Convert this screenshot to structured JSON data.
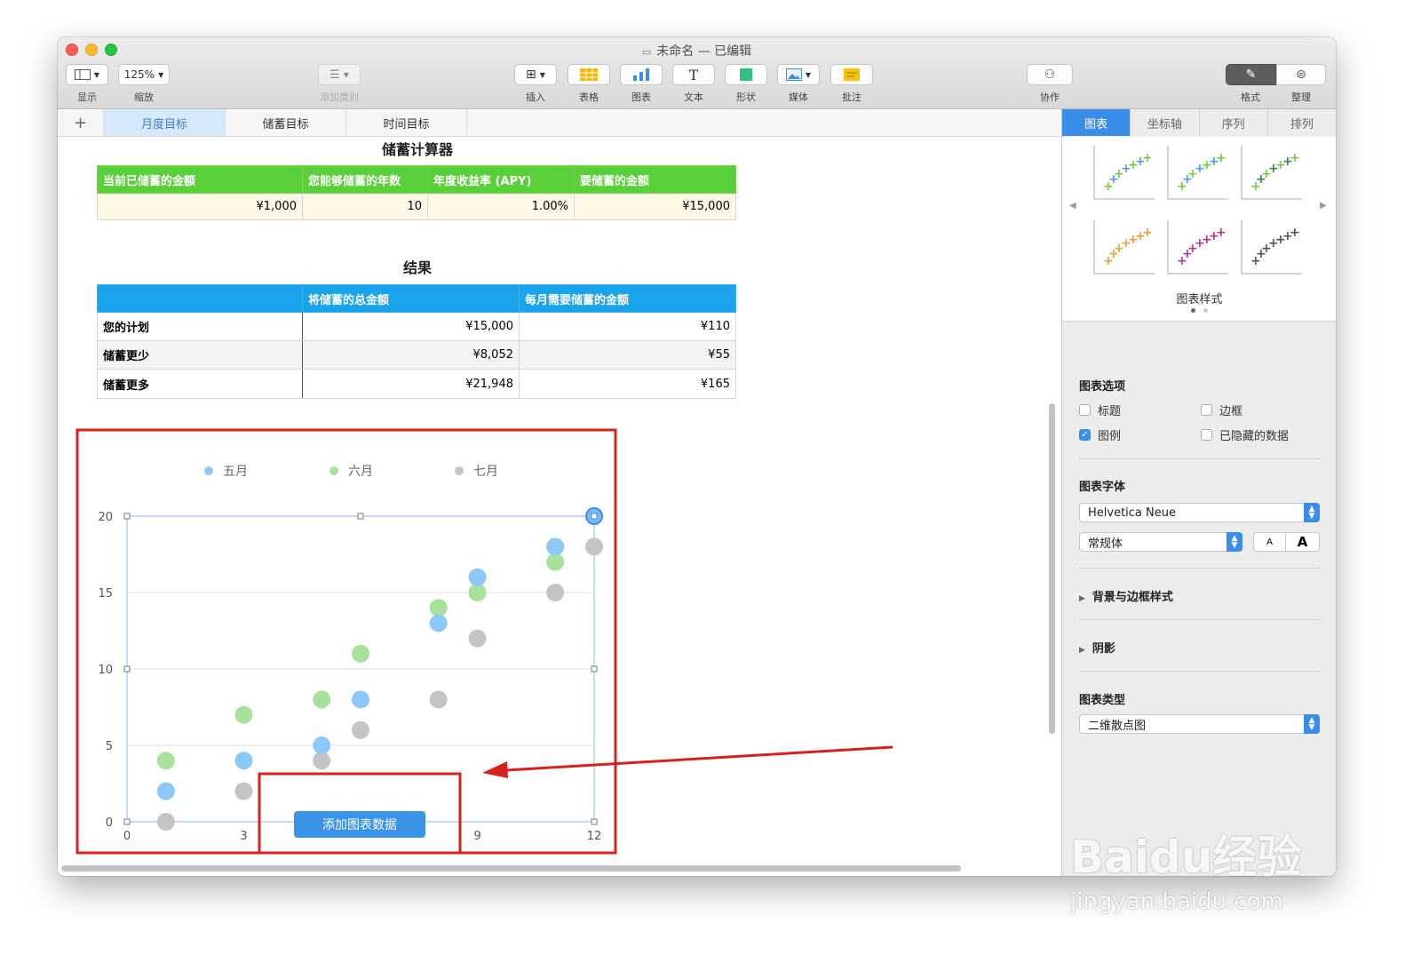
{
  "window": {
    "title": "未命名 — 已编辑"
  },
  "toolbar": {
    "view_label": "显示",
    "zoom_value": "125%",
    "zoom_label": "缩放",
    "add_category_label": "添加类别",
    "insert_label": "插入",
    "table_label": "表格",
    "chart_label": "图表",
    "text_label": "文本",
    "shape_label": "形状",
    "media_label": "媒体",
    "comment_label": "批注",
    "collaborate_label": "协作",
    "format_label": "格式",
    "organize_label": "整理"
  },
  "sheet_tabs": [
    "月度目标",
    "储蓄目标",
    "时间目标"
  ],
  "calculator": {
    "title": "储蓄计算器",
    "headers": [
      "当前已储蓄的金额",
      "您能够储蓄的年数",
      "年度收益率 (APY)",
      "要储蓄的金额"
    ],
    "values": [
      "¥1,000",
      "10",
      "1.00%",
      "¥15,000"
    ]
  },
  "results": {
    "title": "结果",
    "headers": [
      "",
      "将储蓄的总金额",
      "每月需要储蓄的金额"
    ],
    "rows": [
      [
        "您的计划",
        "¥15,000",
        "¥110"
      ],
      [
        "储蓄更少",
        "¥8,052",
        "¥55"
      ],
      [
        "储蓄更多",
        "¥21,948",
        "¥165"
      ]
    ]
  },
  "chart_button": "添加图表数据",
  "chart_data": {
    "type": "scatter",
    "xlim": [
      0,
      12
    ],
    "ylim": [
      0,
      20
    ],
    "xticks": [
      0,
      3,
      9,
      12
    ],
    "yticks": [
      0,
      5,
      10,
      15,
      20
    ],
    "grid": true,
    "legend_position": "top",
    "series": [
      {
        "name": "五月",
        "color": "#8cc8f8",
        "points": [
          [
            1,
            2
          ],
          [
            3,
            4
          ],
          [
            5,
            5
          ],
          [
            6,
            8
          ],
          [
            8,
            13
          ],
          [
            9,
            16
          ],
          [
            11,
            18
          ]
        ]
      },
      {
        "name": "六月",
        "color": "#a8e29a",
        "points": [
          [
            1,
            4
          ],
          [
            3,
            7
          ],
          [
            5,
            8
          ],
          [
            6,
            11
          ],
          [
            8,
            14
          ],
          [
            9,
            15
          ],
          [
            11,
            17
          ]
        ]
      },
      {
        "name": "七月",
        "color": "#c4c4c4",
        "points": [
          [
            1,
            0
          ],
          [
            3,
            2
          ],
          [
            5,
            4
          ],
          [
            6,
            6
          ],
          [
            8,
            8
          ],
          [
            9,
            12
          ],
          [
            11,
            15
          ],
          [
            12,
            18
          ]
        ]
      }
    ]
  },
  "inspector": {
    "tabs": [
      "图表",
      "坐标轴",
      "序列",
      "排列"
    ],
    "styles_label": "图表样式",
    "style_colors": [
      "#4aa3df",
      "#4aa3df",
      "#2e8b57",
      "#f0a030",
      "#b03a8e",
      "#555555"
    ],
    "options_title": "图表选项",
    "opt_title": "标题",
    "opt_border": "边框",
    "opt_legend": "图例",
    "opt_hidden": "已隐藏的数据",
    "font_title": "图表字体",
    "font_family": "Helvetica Neue",
    "font_style": "常规体",
    "font_small": "A",
    "font_large": "A",
    "bg_section": "背景与边框样式",
    "shadow_section": "阴影",
    "type_title": "图表类型",
    "chart_type": "二维散点图"
  },
  "watermark": {
    "brand": "Baidu经验",
    "url": "jingyan.baidu.com"
  }
}
